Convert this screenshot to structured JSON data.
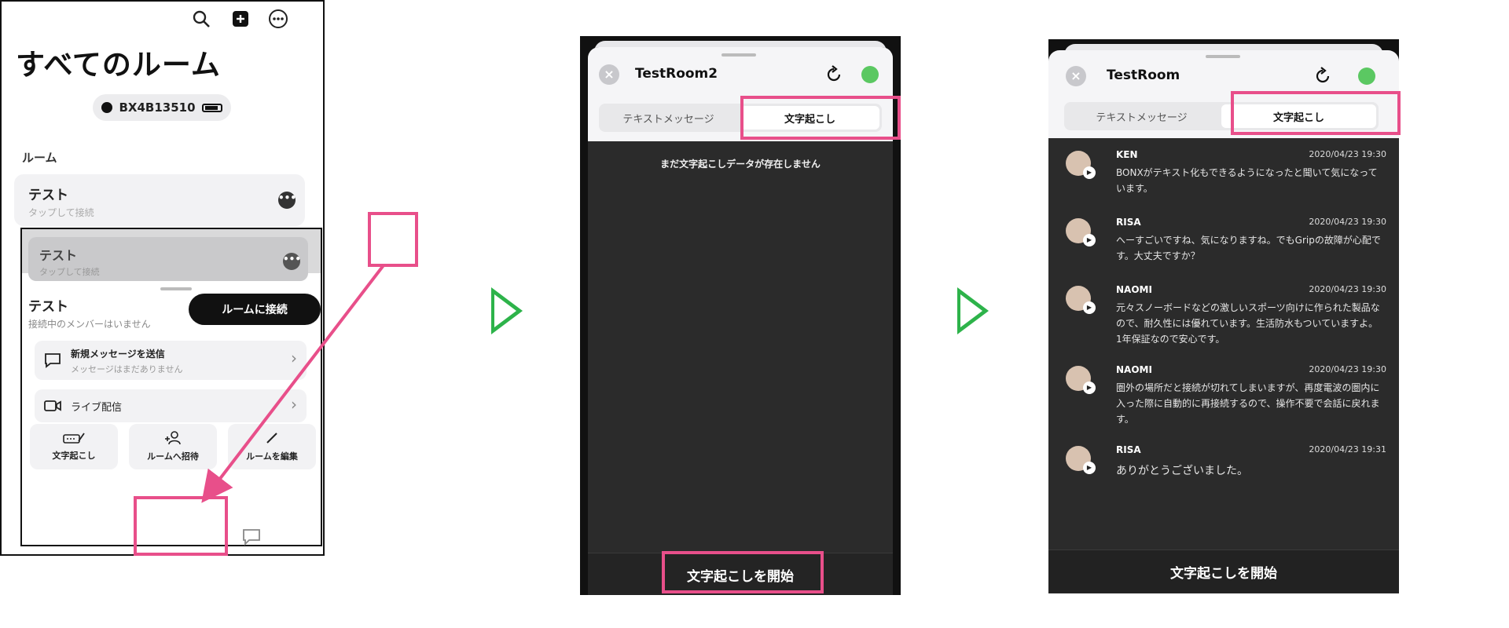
{
  "panel1": {
    "title": "すべてのルーム",
    "device_id": "BX4B13510",
    "section_label": "ルーム",
    "room": {
      "name": "テスト",
      "subtitle": "タップして接続"
    },
    "sheet_room_dim": {
      "name": "テスト",
      "subtitle": "タップして接続"
    },
    "sheet": {
      "name": "テスト",
      "subtitle": "接続中のメンバーはいません",
      "connect_label": "ルームに接続",
      "new_message": {
        "title": "新規メッセージを送信",
        "subtitle": "メッセージはまだありません"
      },
      "live": {
        "title": "ライブ配信"
      },
      "actions": [
        {
          "label": "文字起こし",
          "icon": "transcribe-icon"
        },
        {
          "label": "ルームへ招待",
          "icon": "invite-icon"
        },
        {
          "label": "ルームを編集",
          "icon": "pencil-icon"
        }
      ]
    },
    "badge_color": "#ff6b3d"
  },
  "panel2": {
    "room_title": "TestRoom2",
    "tabs": [
      "テキストメッセージ",
      "文字起こし"
    ],
    "empty_text": "まだ文字起こしデータが存在しません",
    "start_label": "文字起こしを開始"
  },
  "panel3": {
    "room_title": "TestRoom",
    "tabs": [
      "テキストメッセージ",
      "文字起こし"
    ],
    "messages": [
      {
        "name": "KEN",
        "time": "2020/04/23 19:30",
        "text": "BONXがテキスト化もできるようになったと聞いて気になっています。"
      },
      {
        "name": "RISA",
        "time": "2020/04/23 19:30",
        "text": "へーすごいですね、気になりますね。でもGripの故障が心配です。大丈夫ですか？"
      },
      {
        "name": "NAOMI",
        "time": "2020/04/23 19:30",
        "text": "元々スノーボードなどの激しいスポーツ向けに作られた製品なので、耐久性には優れています。生活防水もついていますよ。1年保証なので安心です。"
      },
      {
        "name": "NAOMI",
        "time": "2020/04/23 19:30",
        "text": "圏外の場所だと接続が切れてしまいますが、再度電波の圏内に入った際に自動的に再接続するので、操作不要で会話に戻れます。"
      },
      {
        "name": "RISA",
        "time": "2020/04/23 19:31",
        "text": "ありがとうございました。"
      }
    ],
    "start_label": "文字起こしを開始"
  },
  "colors": {
    "highlight": "#e84f8a",
    "arrow_green": "#2db34a",
    "dark_bg": "#2b2b2b",
    "live_green": "#5bc862"
  }
}
